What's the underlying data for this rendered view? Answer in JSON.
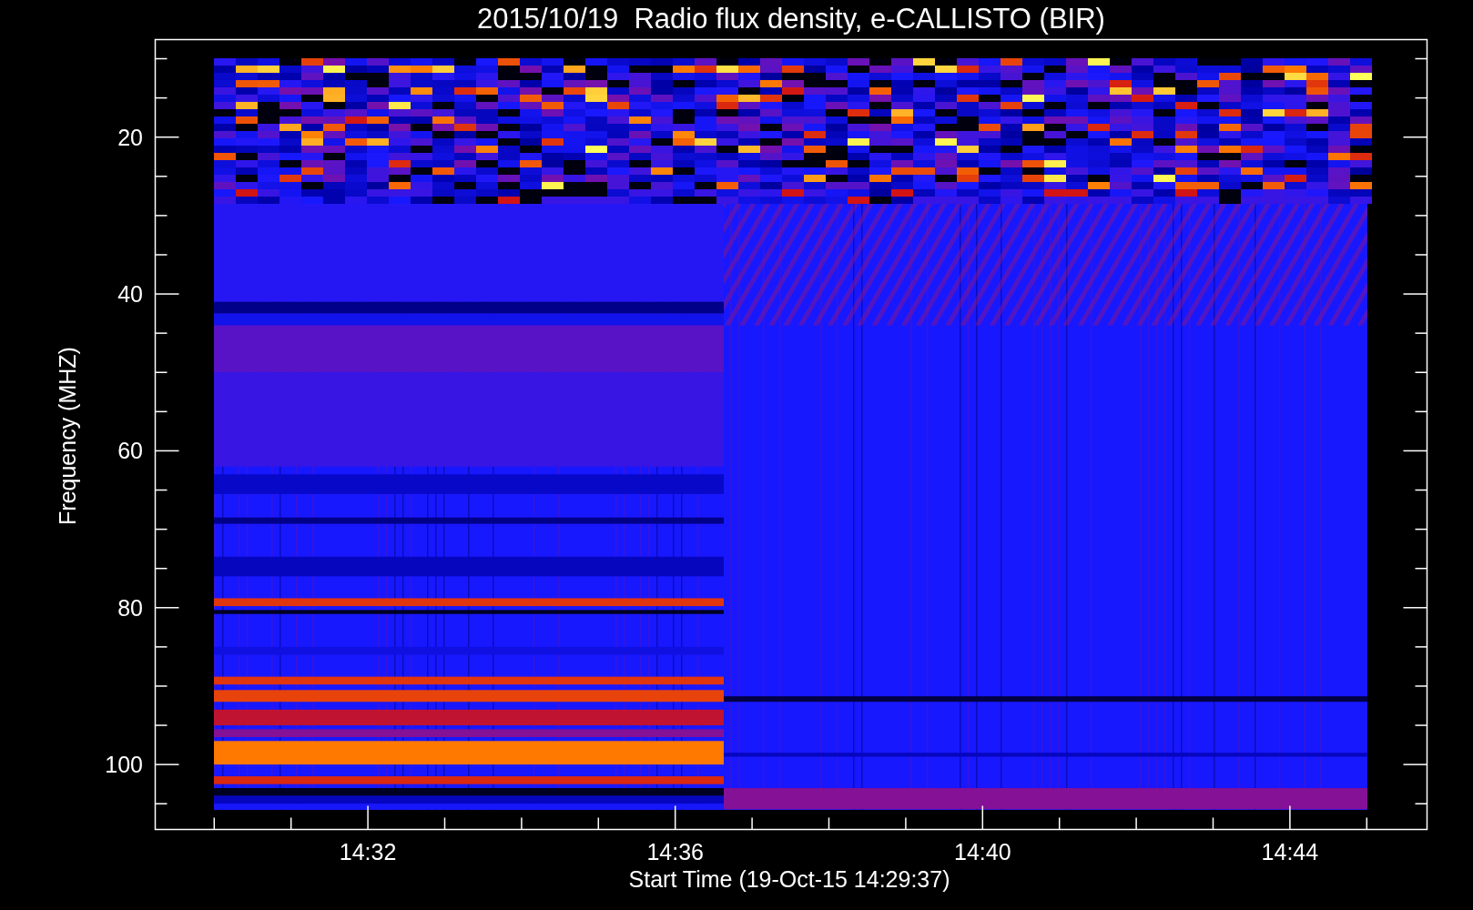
{
  "plot": {
    "title": "2015/10/19  Radio flux density, e-CALLISTO (BIR)",
    "ylabel": "Frequency (MHZ)",
    "xlabel": "Start Time (19-Oct-15 14:29:37)",
    "yticks": [
      {
        "label": "20"
      },
      {
        "label": "40"
      },
      {
        "label": "60"
      },
      {
        "label": "80"
      },
      {
        "label": "100"
      }
    ],
    "xticks": [
      {
        "label": "14:32"
      },
      {
        "label": "14:36"
      },
      {
        "label": "14:40"
      },
      {
        "label": "14:44"
      }
    ]
  }
}
